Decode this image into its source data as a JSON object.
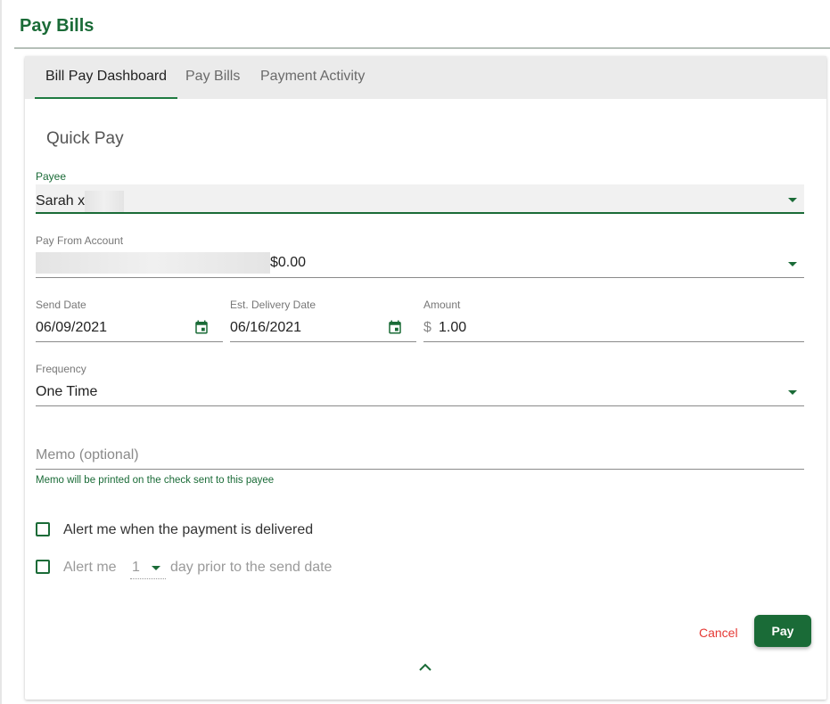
{
  "page": {
    "title": "Pay Bills"
  },
  "tabs": [
    {
      "label": "Bill Pay Dashboard",
      "active": true
    },
    {
      "label": "Pay Bills",
      "active": false
    },
    {
      "label": "Payment Activity",
      "active": false
    }
  ],
  "quick_pay": {
    "title": "Quick Pay",
    "payee": {
      "label": "Payee",
      "value": "Sarah x"
    },
    "pay_from": {
      "label": "Pay From Account",
      "balance": "$0.00"
    },
    "send_date": {
      "label": "Send Date",
      "value": "06/09/2021"
    },
    "delivery_date": {
      "label": "Est. Delivery Date",
      "value": "06/16/2021"
    },
    "amount": {
      "label": "Amount",
      "currency": "$",
      "value": "1.00"
    },
    "frequency": {
      "label": "Frequency",
      "value": "One Time"
    },
    "memo": {
      "placeholder": "Memo (optional)",
      "hint": "Memo will be printed on the check sent to this payee"
    },
    "alert_delivered": {
      "label": "Alert me when the payment is delivered"
    },
    "alert_prior": {
      "prefix": "Alert me",
      "days": "1",
      "suffix": "day prior to the send date"
    },
    "cancel_label": "Cancel",
    "pay_label": "Pay"
  },
  "colors": {
    "accent": "#1a6b37",
    "cancel": "#e53935"
  },
  "icons": [
    "calendar-icon",
    "chevron-down-icon",
    "chevron-up-icon"
  ]
}
